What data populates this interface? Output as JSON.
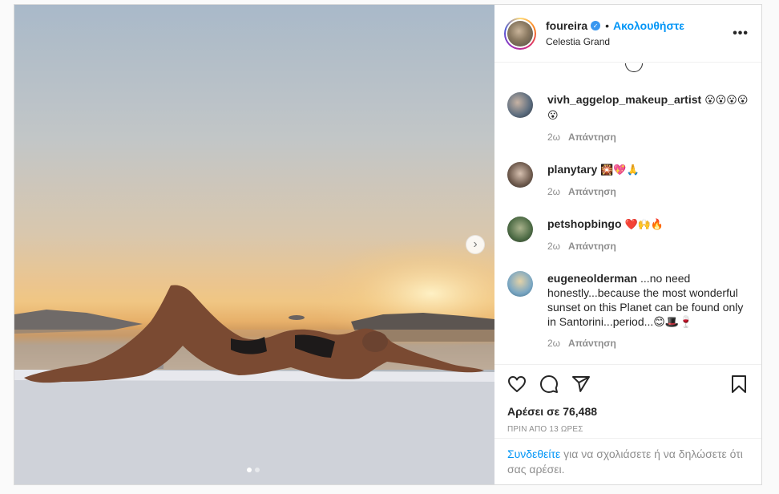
{
  "post": {
    "username": "foureira",
    "follow_label": "Ακολουθήστε",
    "location": "Celestia Grand",
    "more_label": "•••",
    "verified_mark": "✓",
    "separator": "•",
    "carousel_next": "›",
    "colors": {
      "accent": "#0095f6",
      "verified": "#3897f0",
      "muted": "#8e8e8e",
      "text": "#262626"
    }
  },
  "comments": [
    {
      "user": "vivh_aggelop_makeup_artist",
      "text": "😮😮😮😮😮",
      "age": "2ω",
      "reply": "Απάντηση",
      "avatar_color": "#5a6b7d"
    },
    {
      "user": "planytary",
      "text": "🎇💖🙏",
      "age": "2ω",
      "reply": "Απάντηση",
      "avatar_color": "#6e5a4d"
    },
    {
      "user": "petshopbingo",
      "text": "❤️🙌🔥",
      "age": "2ω",
      "reply": "Απάντηση",
      "avatar_color": "#4d6b45"
    },
    {
      "user": "eugeneolderman",
      "text": "...no need honestly...because the most wonderful sunset on this Planet can be found only in Santorini...period...😊🎩🍷",
      "age": "2ω",
      "reply": "Απάντηση",
      "avatar_color": "#7aa6c2"
    }
  ],
  "actions": {
    "icons": [
      "heart-icon",
      "comment-icon",
      "share-icon",
      "bookmark-icon"
    ],
    "likes": "Αρέσει σε 76,488",
    "time": "ΠΡΙΝ ΑΠΟ 13 ΩΡΕΣ"
  },
  "login": {
    "link": "Συνδεθείτε",
    "text": " για να σχολιάσετε ή να δηλώσετε ότι σας αρέσει."
  }
}
